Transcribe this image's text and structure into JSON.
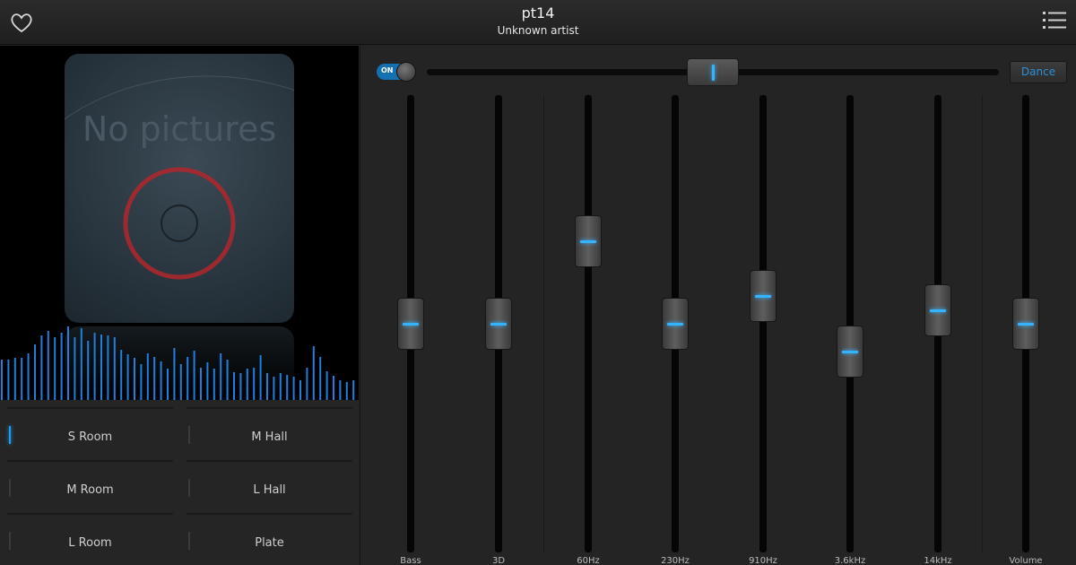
{
  "header": {
    "title": "pt14",
    "subtitle": "Unknown artist"
  },
  "cover": {
    "text": "No pictures"
  },
  "reverb_presets": [
    {
      "label": "S Room",
      "selected": true
    },
    {
      "label": "M Hall",
      "selected": false
    },
    {
      "label": "M Room",
      "selected": false
    },
    {
      "label": "L Hall",
      "selected": false
    },
    {
      "label": "L Room",
      "selected": false
    },
    {
      "label": "Plate",
      "selected": false
    }
  ],
  "effect_toggle": {
    "label": "ON",
    "on": true
  },
  "preset_button": {
    "label": "Dance"
  },
  "bands": [
    {
      "label": "Bass",
      "level": 0.5
    },
    {
      "label": "3D",
      "level": 0.5
    },
    {
      "label": "60Hz",
      "level": 0.68
    },
    {
      "label": "230Hz",
      "level": 0.5
    },
    {
      "label": "910Hz",
      "level": 0.56
    },
    {
      "label": "3.6kHz",
      "level": 0.44
    },
    {
      "label": "14kHz",
      "level": 0.53
    },
    {
      "label": "Volume",
      "level": 0.5
    }
  ],
  "colors": {
    "accent": "#35b3ff",
    "cover_ring": "#b0272d"
  }
}
